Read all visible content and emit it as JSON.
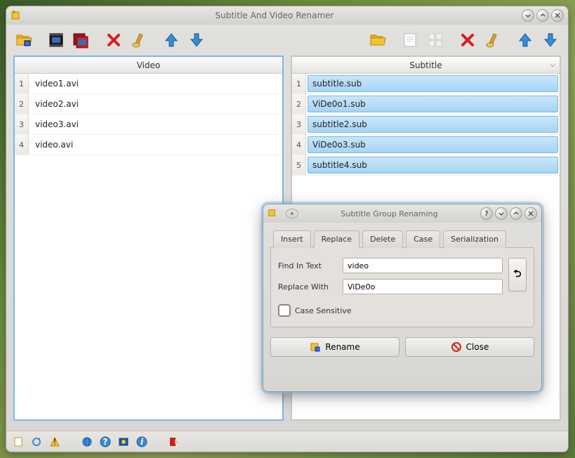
{
  "main": {
    "title": "Subtitle And Video Renamer",
    "video_header": "Video",
    "subtitle_header": "Subtitle",
    "videos": [
      "video1.avi",
      "video2.avi",
      "video3.avi",
      "video.avi"
    ],
    "subtitles": [
      "subtitle.sub",
      "ViDe0o1.sub",
      "subtitle2.sub",
      "ViDe0o3.sub",
      "subtitle4.sub"
    ]
  },
  "dialog": {
    "title": "Subtitle Group Renaming",
    "tabs": {
      "insert": "Insert",
      "replace": "Replace",
      "delete": "Delete",
      "case": "Case",
      "serial": "Serialization"
    },
    "find_label": "Find In Text",
    "replace_label": "Replace With",
    "find_value": "video",
    "replace_value": "ViDe0o",
    "case_sensitive": "Case Sensitive",
    "rename_btn": "Rename",
    "close_btn": "Close"
  }
}
